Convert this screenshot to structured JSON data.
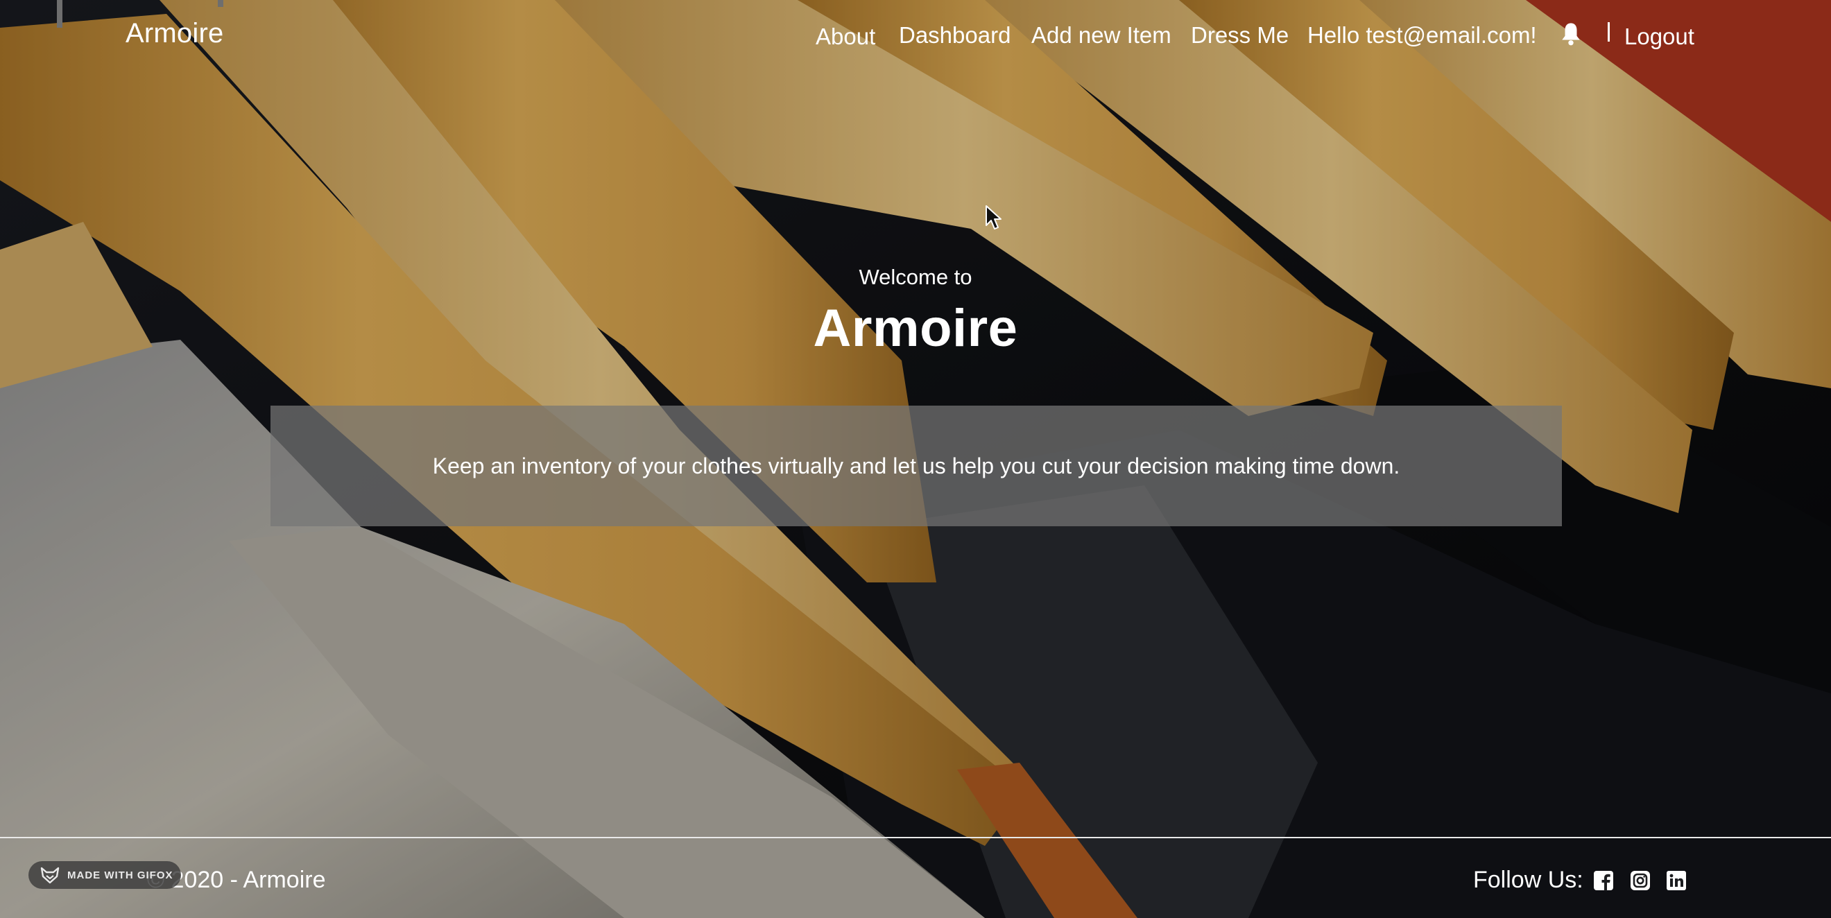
{
  "navbar": {
    "brand": "Armoire",
    "links": [
      "About",
      "Dashboard",
      "Add new Item",
      "Dress Me",
      "Hello test@email.com!"
    ],
    "notification_icon": "bell-icon",
    "logout": "Logout"
  },
  "hero": {
    "subtitle": "Welcome to",
    "title": "Armoire",
    "tagline": "Keep an inventory of your clothes virtually and let us help you cut your decision making time down."
  },
  "footer": {
    "copyright": "2020 - Armoire",
    "follow_label": "Follow Us:",
    "social_icons": [
      "facebook-icon",
      "instagram-icon",
      "linkedin-icon"
    ]
  },
  "watermark": {
    "text": "MADE WITH GIFOX"
  },
  "colors": {
    "text": "#ffffff",
    "tagline_box": "#767676",
    "footer_divider": "#e9e9e9"
  }
}
